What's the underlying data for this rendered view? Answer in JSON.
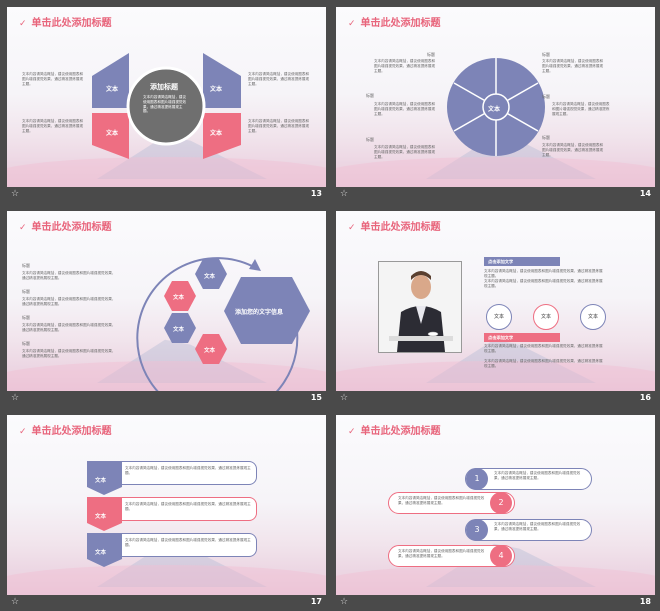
{
  "slide_title": "单击此处添加标题",
  "body_text": "文本内容请简洁概括，建议使用图表和图片增强视觉效果，通过精准提炼展现主题。",
  "label": "文本",
  "heading": "标题",
  "slides": [
    {
      "num": "13",
      "center_label": "添加标题"
    },
    {
      "num": "14"
    },
    {
      "num": "15",
      "center_label": "添加您的文字信息"
    },
    {
      "num": "16",
      "caption_1": "点击添加文字",
      "caption_2": "点击添加文字"
    },
    {
      "num": "17"
    },
    {
      "num": "18",
      "steps": [
        "1",
        "2",
        "3",
        "4"
      ]
    }
  ],
  "colors": {
    "pink": "#ee6e82",
    "purple": "#7d84b7",
    "gray": "#6f6f6f",
    "title": "#e8657c"
  }
}
